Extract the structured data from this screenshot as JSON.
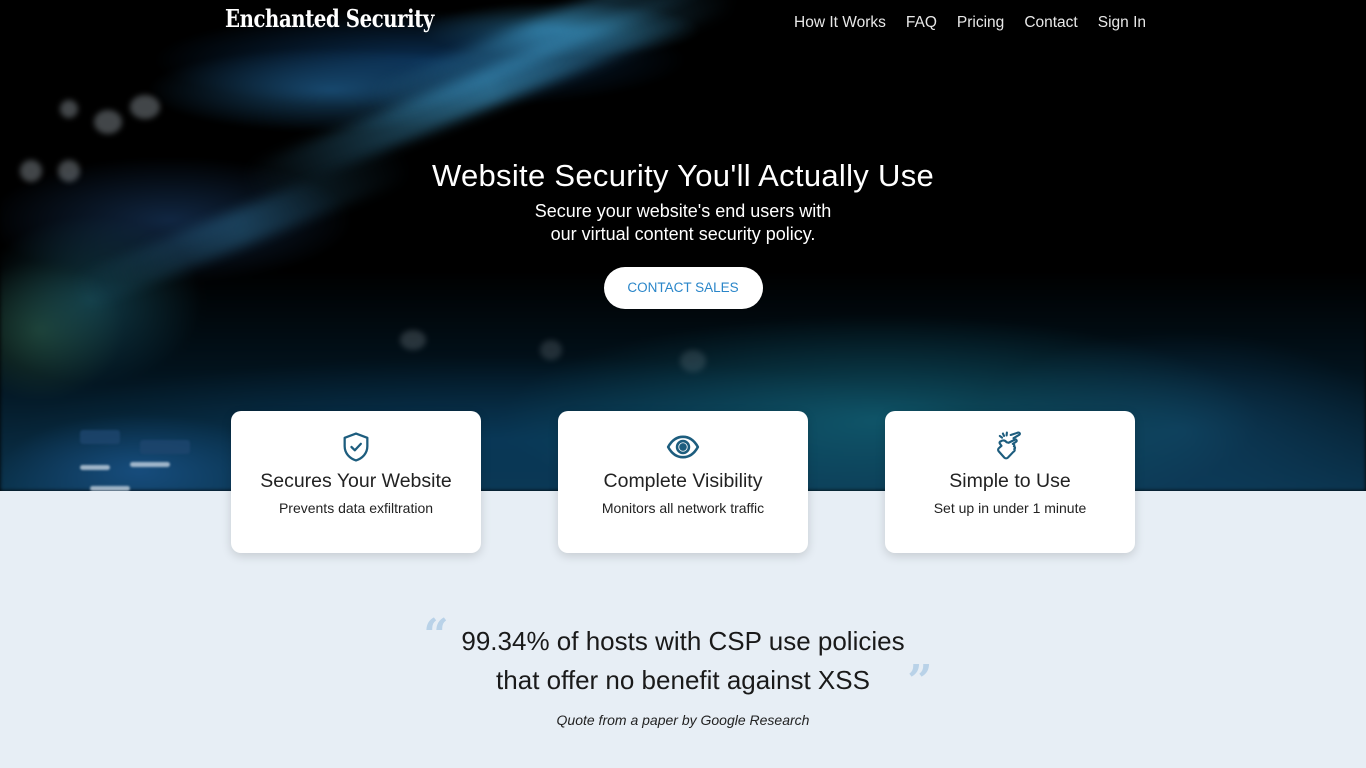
{
  "brand": {
    "name": "Enchanted Security"
  },
  "nav": {
    "links": [
      {
        "label": "How It Works"
      },
      {
        "label": "FAQ"
      },
      {
        "label": "Pricing"
      },
      {
        "label": "Contact"
      },
      {
        "label": "Sign In"
      }
    ]
  },
  "hero": {
    "title": "Website Security You'll Actually Use",
    "subtitle_line1": "Secure your website's end users with",
    "subtitle_line2": "our virtual content security policy.",
    "cta_label": "CONTACT SALES"
  },
  "features": [
    {
      "icon": "shield-check-icon",
      "title": "Secures Your Website",
      "description": "Prevents data exfiltration"
    },
    {
      "icon": "eye-icon",
      "title": "Complete Visibility",
      "description": "Monitors all network traffic"
    },
    {
      "icon": "finger-snap-icon",
      "title": "Simple to Use",
      "description": "Set up in under 1 minute"
    }
  ],
  "quote": {
    "open_mark": "“",
    "close_mark": "”",
    "line1": "99.34% of hosts with CSP use policies",
    "line2": "that offer no benefit against XSS",
    "source": "Quote from a paper by Google Research"
  },
  "colors": {
    "accent": "#2a86c9",
    "icon": "#1d5d7e",
    "section_bg": "#e7eef5",
    "quote_mark": "#b9d2e8"
  }
}
